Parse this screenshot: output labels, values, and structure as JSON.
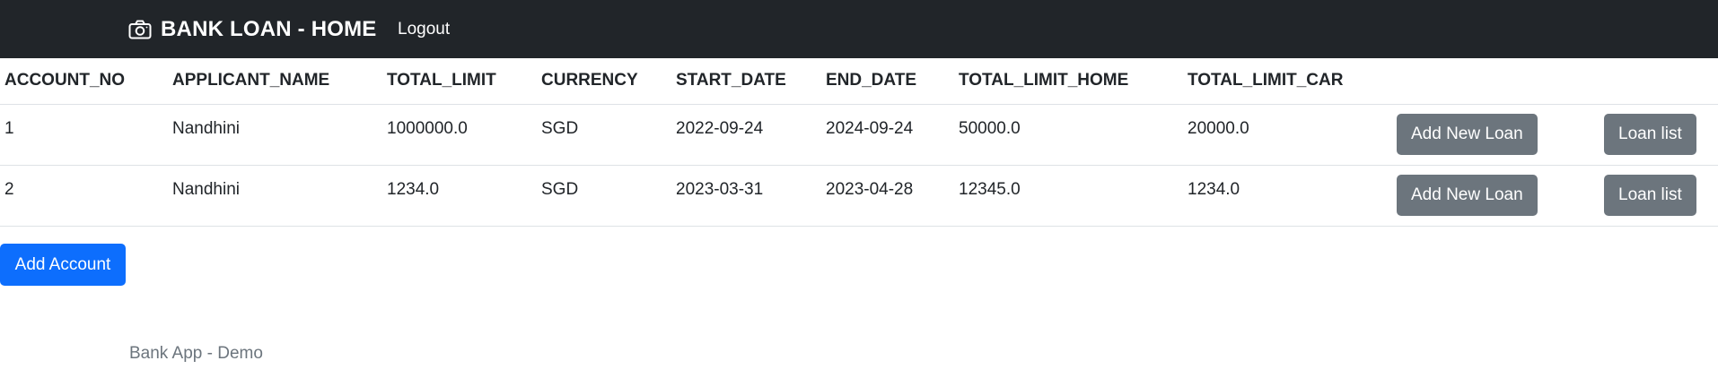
{
  "navbar": {
    "brand": "BANK LOAN - HOME",
    "brand_icon": "camera-icon",
    "logout_label": "Logout"
  },
  "table": {
    "headers": [
      "ACCOUNT_NO",
      "APPLICANT_NAME",
      "TOTAL_LIMIT",
      "CURRENCY",
      "START_DATE",
      "END_DATE",
      "TOTAL_LIMIT_HOME",
      "TOTAL_LIMIT_CAR"
    ],
    "rows": [
      {
        "account_no": "1",
        "applicant_name": "Nandhini",
        "total_limit": "1000000.0",
        "currency": "SGD",
        "start_date": "2022-09-24",
        "end_date": "2024-09-24",
        "total_limit_home": "50000.0",
        "total_limit_car": "20000.0",
        "add_loan_label": "Add New Loan",
        "loan_list_label": "Loan list"
      },
      {
        "account_no": "2",
        "applicant_name": "Nandhini",
        "total_limit": "1234.0",
        "currency": "SGD",
        "start_date": "2023-03-31",
        "end_date": "2023-04-28",
        "total_limit_home": "12345.0",
        "total_limit_car": "1234.0",
        "add_loan_label": "Add New Loan",
        "loan_list_label": "Loan list"
      }
    ]
  },
  "add_account_label": "Add Account",
  "footer_text": "Bank App - Demo",
  "colors": {
    "navbar_bg": "#212529",
    "secondary_button": "#6c757d",
    "primary_button": "#0d6efd",
    "footer_text": "#6c757d"
  }
}
